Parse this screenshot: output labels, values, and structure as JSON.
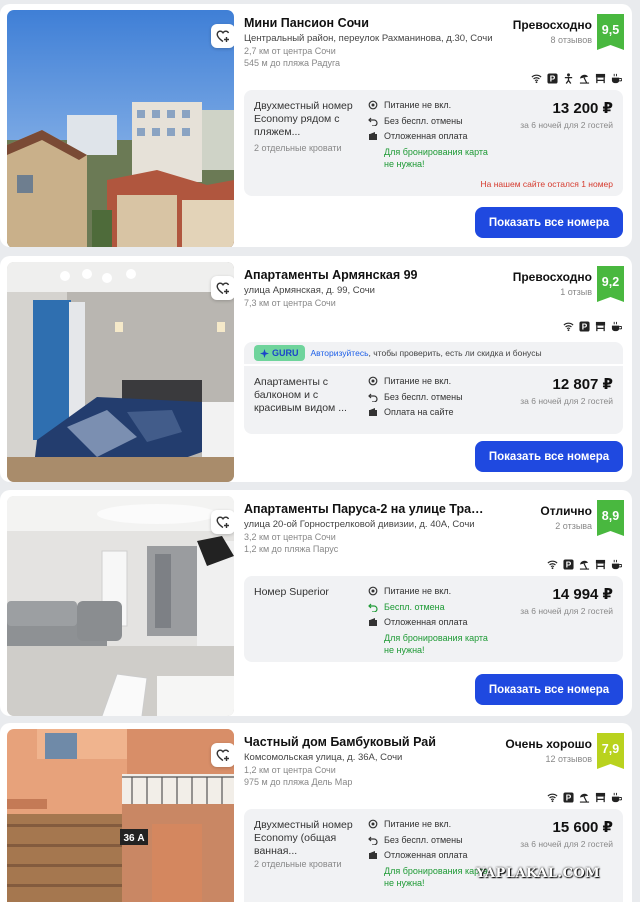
{
  "colors": {
    "accent": "#1f49e0",
    "badge_green": "#49b83f",
    "badge_yellow": "#b9d21e",
    "free_green": "#1e9a35",
    "warn_red": "#d63b2e"
  },
  "button_label": "Показать все номера",
  "hotels": [
    {
      "name": "Мини Пансион Сочи",
      "address": "Центральный район, переулок Рахманинова, д.30, Сочи",
      "distance_center": "2,7 км от центра Сочи",
      "distance_beach": "545 м до пляжа Радуга",
      "rating_word": "Превосходно",
      "rating_count": "8 отзывов",
      "score": "9,5",
      "amenities": [
        "wifi-icon",
        "parking-icon",
        "kids-icon",
        "beach-icon",
        "restaurant-icon",
        "breakfast-icon"
      ],
      "room": {
        "name": "Двухместный номер Economy рядом с пляжем...",
        "beds": "2 отдельные кровати",
        "features": [
          "Питание не вкл.",
          "Без беспл. отмены",
          "Отложенная оплата"
        ],
        "note": "Для бронирования карта не нужна!",
        "price": "13 200 ₽",
        "nights": "за 6 ночей для 2 гостей",
        "alert": "На нашем сайте остался 1 номер"
      }
    },
    {
      "name": "Апартаменты Армянская 99",
      "address": "улица Армянская, д. 99, Сочи",
      "distance_center": "7,3 км от центра Сочи",
      "rating_word": "Превосходно",
      "rating_count": "1 отзыв",
      "score": "9,2",
      "amenities": [
        "wifi-icon",
        "parking-icon",
        "restaurant-icon",
        "breakfast-icon"
      ],
      "guru": {
        "label": "GURU",
        "link": "Авторизуйтесь",
        "text": ", чтобы проверить, есть ли скидка и бонусы"
      },
      "room": {
        "name": "Апартаменты с балконом и с красивым видом ...",
        "features": [
          "Питание не вкл.",
          "Без беспл. отмены",
          "Оплата на сайте"
        ],
        "price": "12 807 ₽",
        "nights": "за 6 ночей для 2 гостей"
      }
    },
    {
      "name": "Апартаменты Паруса-2 на улице Транс...",
      "address": "улица 20-ой Горнострелковой дивизии, д. 40А, Сочи",
      "distance_center": "3,2 км от центра Сочи",
      "distance_beach": "1,2 км до пляжа Парус",
      "rating_word": "Отлично",
      "rating_count": "2 отзыва",
      "score": "8,9",
      "amenities": [
        "wifi-icon",
        "parking-icon",
        "beach-icon",
        "restaurant-icon",
        "breakfast-icon"
      ],
      "room": {
        "name": "Номер Superior",
        "features": [
          "Питание не вкл.",
          "Беспл. отмена",
          "Отложенная оплата"
        ],
        "note": "Для бронирования карта не нужна!",
        "price": "14 994 ₽",
        "nights": "за 6 ночей для 2 гостей"
      }
    },
    {
      "name": "Частный дом Бамбуковый Рай",
      "address": "Комсомольская улица, д. 36А, Сочи",
      "distance_center": "1,2 км от центра Сочи",
      "distance_beach": "975 м до пляжа Дель Мар",
      "rating_word": "Очень хорошо",
      "rating_count": "12 отзывов",
      "score": "7,9",
      "amenities": [
        "wifi-icon",
        "parking-icon",
        "beach-icon",
        "restaurant-icon",
        "breakfast-icon"
      ],
      "room": {
        "name": "Двухместный номер Economy (общая ванная...",
        "beds": "2 отдельные кровати",
        "features": [
          "Питание не вкл.",
          "Без беспл. отмены",
          "Отложенная оплата"
        ],
        "note": "Для бронирования карта не нужна!",
        "price": "15 600 ₽",
        "nights": "за 6 ночей для 2 гостей"
      }
    }
  ],
  "photo_labels": {
    "house_number": "36 А"
  },
  "watermark": "YAPLAKAL.COM"
}
